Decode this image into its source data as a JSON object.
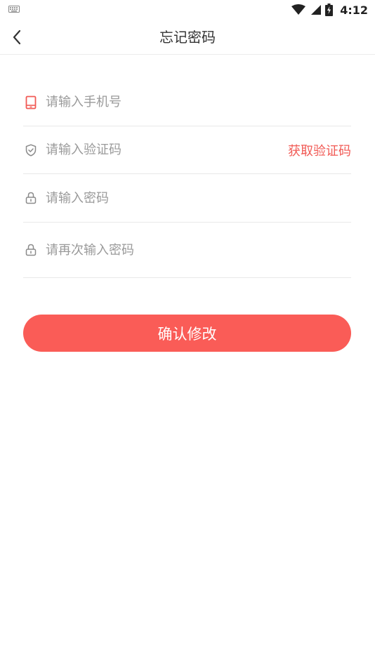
{
  "status_bar": {
    "time": "4:12",
    "icons": [
      "keyboard-icon",
      "wifi-icon",
      "signal-icon",
      "battery-icon"
    ]
  },
  "header": {
    "title": "忘记密码",
    "back_icon": "chevron-left-icon"
  },
  "form": {
    "phone": {
      "placeholder": "请输入手机号",
      "value": "",
      "icon": "phone-icon"
    },
    "code": {
      "placeholder": "请输入验证码",
      "value": "",
      "icon": "shield-check-icon",
      "action_label": "获取验证码"
    },
    "password": {
      "placeholder": "请输入密码",
      "value": "",
      "icon": "lock-icon"
    },
    "password_confirm": {
      "placeholder": "请再次输入密码",
      "value": "",
      "icon": "lock-icon"
    }
  },
  "confirm_button": {
    "label": "确认修改"
  },
  "colors": {
    "accent": "#fa5c57",
    "link": "#f15a55",
    "placeholder": "#9a9a9a",
    "divider": "#e8e8e8"
  }
}
